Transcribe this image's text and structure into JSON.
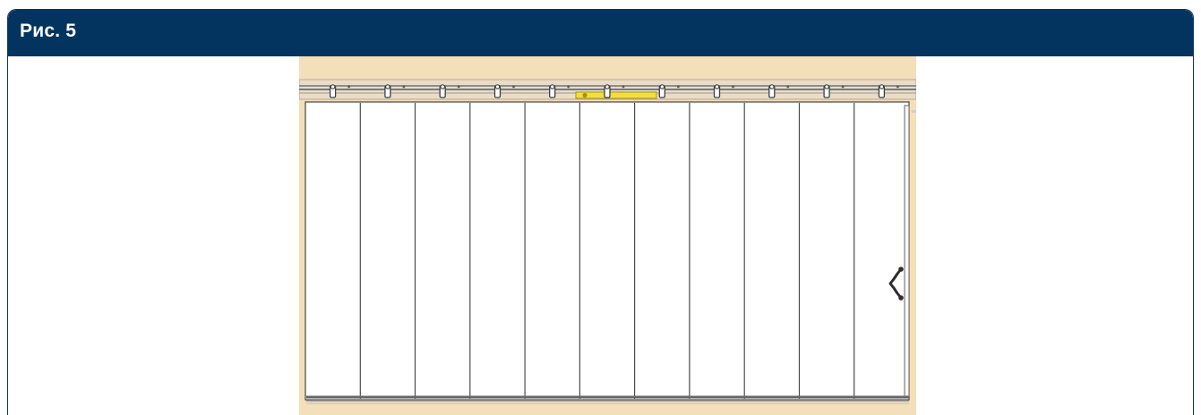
{
  "figure": {
    "title": "Рис. 5",
    "panel_count": 11,
    "colors": {
      "header_bg": "#02345f",
      "header_text": "#ffffff",
      "wall": "#f4dfbb",
      "panel": "#ffffff",
      "line": "#444444",
      "track": "#6f6f6f",
      "highlight": "#f1e03c"
    },
    "icons": {
      "handle": "curved-handle-icon"
    }
  }
}
